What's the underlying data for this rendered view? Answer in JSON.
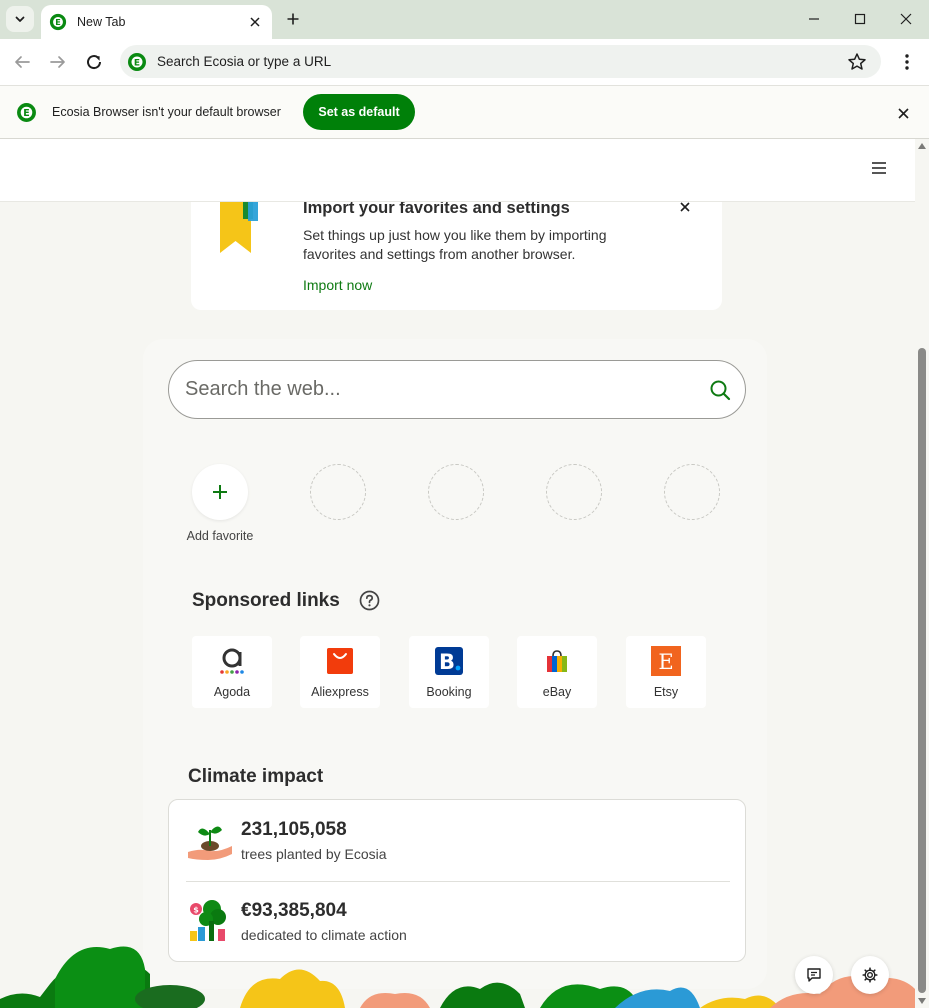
{
  "browser": {
    "tab": {
      "title": "New Tab"
    },
    "omnibox": {
      "placeholder": "Search Ecosia or type a URL"
    },
    "infobar": {
      "message": "Ecosia Browser isn't your default browser",
      "button": "Set as default"
    }
  },
  "import_card": {
    "title": "Import your favorites and settings",
    "description": "Set things up just how you like them by importing favorites and settings from another browser.",
    "link": "Import now"
  },
  "search": {
    "placeholder": "Search the web..."
  },
  "favorites": {
    "add_label": "Add favorite",
    "empty_slots": 4
  },
  "sponsored": {
    "title": "Sponsored links",
    "items": [
      {
        "label": "Agoda"
      },
      {
        "label": "Aliexpress"
      },
      {
        "label": "Booking"
      },
      {
        "label": "eBay"
      },
      {
        "label": "Etsy"
      }
    ]
  },
  "climate": {
    "title": "Climate impact",
    "trees_count": "231,105,058",
    "trees_label": "trees planted by Ecosia",
    "money_count": "€93,385,804",
    "money_label": "dedicated to climate action"
  },
  "colors": {
    "brand_green": "#008009",
    "link_green": "#0e7a12",
    "tabstrip_bg": "#d9e3d7",
    "page_bg": "#f6f6f2"
  },
  "icons": [
    "tab-search-icon",
    "ecosia-logo-icon",
    "close-icon",
    "plus-icon",
    "minimize-icon",
    "maximize-icon",
    "back-icon",
    "forward-icon",
    "reload-icon",
    "star-icon",
    "kebab-menu-icon",
    "hamburger-icon",
    "search-icon",
    "help-icon",
    "feedback-icon",
    "gear-icon"
  ]
}
